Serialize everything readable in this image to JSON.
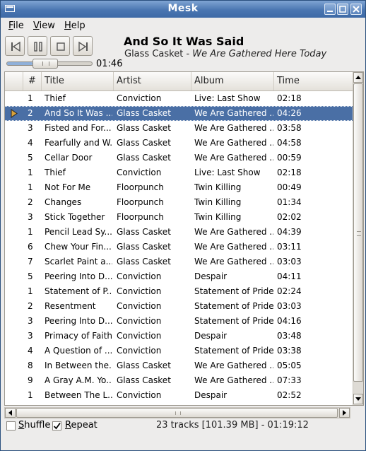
{
  "window": {
    "title": "Mesk"
  },
  "menu": [
    {
      "mnemonic": "F",
      "rest": "ile"
    },
    {
      "mnemonic": "V",
      "rest": "iew"
    },
    {
      "mnemonic": "H",
      "rest": "elp"
    }
  ],
  "controls": [
    "previous",
    "pause",
    "stop",
    "next"
  ],
  "now_playing": {
    "title": "And So It Was Said",
    "artist": "Glass Casket",
    "separator": " - ",
    "album": "We Are Gathered Here Today"
  },
  "seek": {
    "elapsed": "01:46",
    "progress": 0.3
  },
  "columns": [
    "#",
    "Title",
    "Artist",
    "Album",
    "Time"
  ],
  "tracks": [
    {
      "num": "1",
      "title": "Thief",
      "artist": "Conviction",
      "album": "Live: Last Show",
      "time": "02:18",
      "playing": false
    },
    {
      "num": "2",
      "title": "And So It Was ...",
      "artist": "Glass Casket",
      "album": "We Are Gathered ...",
      "time": "04:26",
      "playing": true
    },
    {
      "num": "3",
      "title": "Fisted and For...",
      "artist": "Glass Casket",
      "album": "We Are Gathered ...",
      "time": "03:58",
      "playing": false
    },
    {
      "num": "4",
      "title": "Fearfully and W...",
      "artist": "Glass Casket",
      "album": "We Are Gathered ...",
      "time": "04:58",
      "playing": false
    },
    {
      "num": "5",
      "title": "Cellar Door",
      "artist": "Glass Casket",
      "album": "We Are Gathered ...",
      "time": "00:59",
      "playing": false
    },
    {
      "num": "1",
      "title": "Thief",
      "artist": "Conviction",
      "album": "Live: Last Show",
      "time": "02:18",
      "playing": false
    },
    {
      "num": "1",
      "title": "Not For Me",
      "artist": "Floorpunch",
      "album": "Twin Killing",
      "time": "00:49",
      "playing": false
    },
    {
      "num": "2",
      "title": "Changes",
      "artist": "Floorpunch",
      "album": "Twin Killing",
      "time": "01:34",
      "playing": false
    },
    {
      "num": "3",
      "title": "Stick Together",
      "artist": "Floorpunch",
      "album": "Twin Killing",
      "time": "02:02",
      "playing": false
    },
    {
      "num": "1",
      "title": "Pencil Lead Sy...",
      "artist": "Glass Casket",
      "album": "We Are Gathered ...",
      "time": "04:39",
      "playing": false
    },
    {
      "num": "6",
      "title": "Chew Your Fin...",
      "artist": "Glass Casket",
      "album": "We Are Gathered ...",
      "time": "03:11",
      "playing": false
    },
    {
      "num": "7",
      "title": "Scarlet Paint a...",
      "artist": "Glass Casket",
      "album": "We Are Gathered ...",
      "time": "03:03",
      "playing": false
    },
    {
      "num": "5",
      "title": "Peering Into D...",
      "artist": "Conviction",
      "album": "Despair",
      "time": "04:11",
      "playing": false
    },
    {
      "num": "1",
      "title": "Statement of P...",
      "artist": "Conviction",
      "album": "Statement of Pride",
      "time": "02:24",
      "playing": false
    },
    {
      "num": "2",
      "title": "Resentment",
      "artist": "Conviction",
      "album": "Statement of Pride",
      "time": "03:03",
      "playing": false
    },
    {
      "num": "3",
      "title": "Peering Into D...",
      "artist": "Conviction",
      "album": "Statement of Pride",
      "time": "04:16",
      "playing": false
    },
    {
      "num": "3",
      "title": "Primacy of Faith",
      "artist": "Conviction",
      "album": "Despair",
      "time": "03:48",
      "playing": false
    },
    {
      "num": "4",
      "title": "A Question of ...",
      "artist": "Conviction",
      "album": "Statement of Pride",
      "time": "03:38",
      "playing": false
    },
    {
      "num": "8",
      "title": "In Between the...",
      "artist": "Glass Casket",
      "album": "We Are Gathered ...",
      "time": "05:05",
      "playing": false
    },
    {
      "num": "9",
      "title": "A Gray A.M. Yo...",
      "artist": "Glass Casket",
      "album": "We Are Gathered ...",
      "time": "07:33",
      "playing": false
    },
    {
      "num": "1",
      "title": "Between The L...",
      "artist": "Conviction",
      "album": "Despair",
      "time": "02:52",
      "playing": false
    }
  ],
  "options": {
    "shuffle": {
      "mnemonic": "S",
      "rest": "huffle",
      "checked": false
    },
    "repeat": {
      "mnemonic": "R",
      "rest": "epeat",
      "checked": true
    }
  },
  "status": "23 tracks [101.39 MB] - 01:19:12",
  "colors": {
    "titlebar": "#4a76b1",
    "selection": "#4a6fa5"
  }
}
